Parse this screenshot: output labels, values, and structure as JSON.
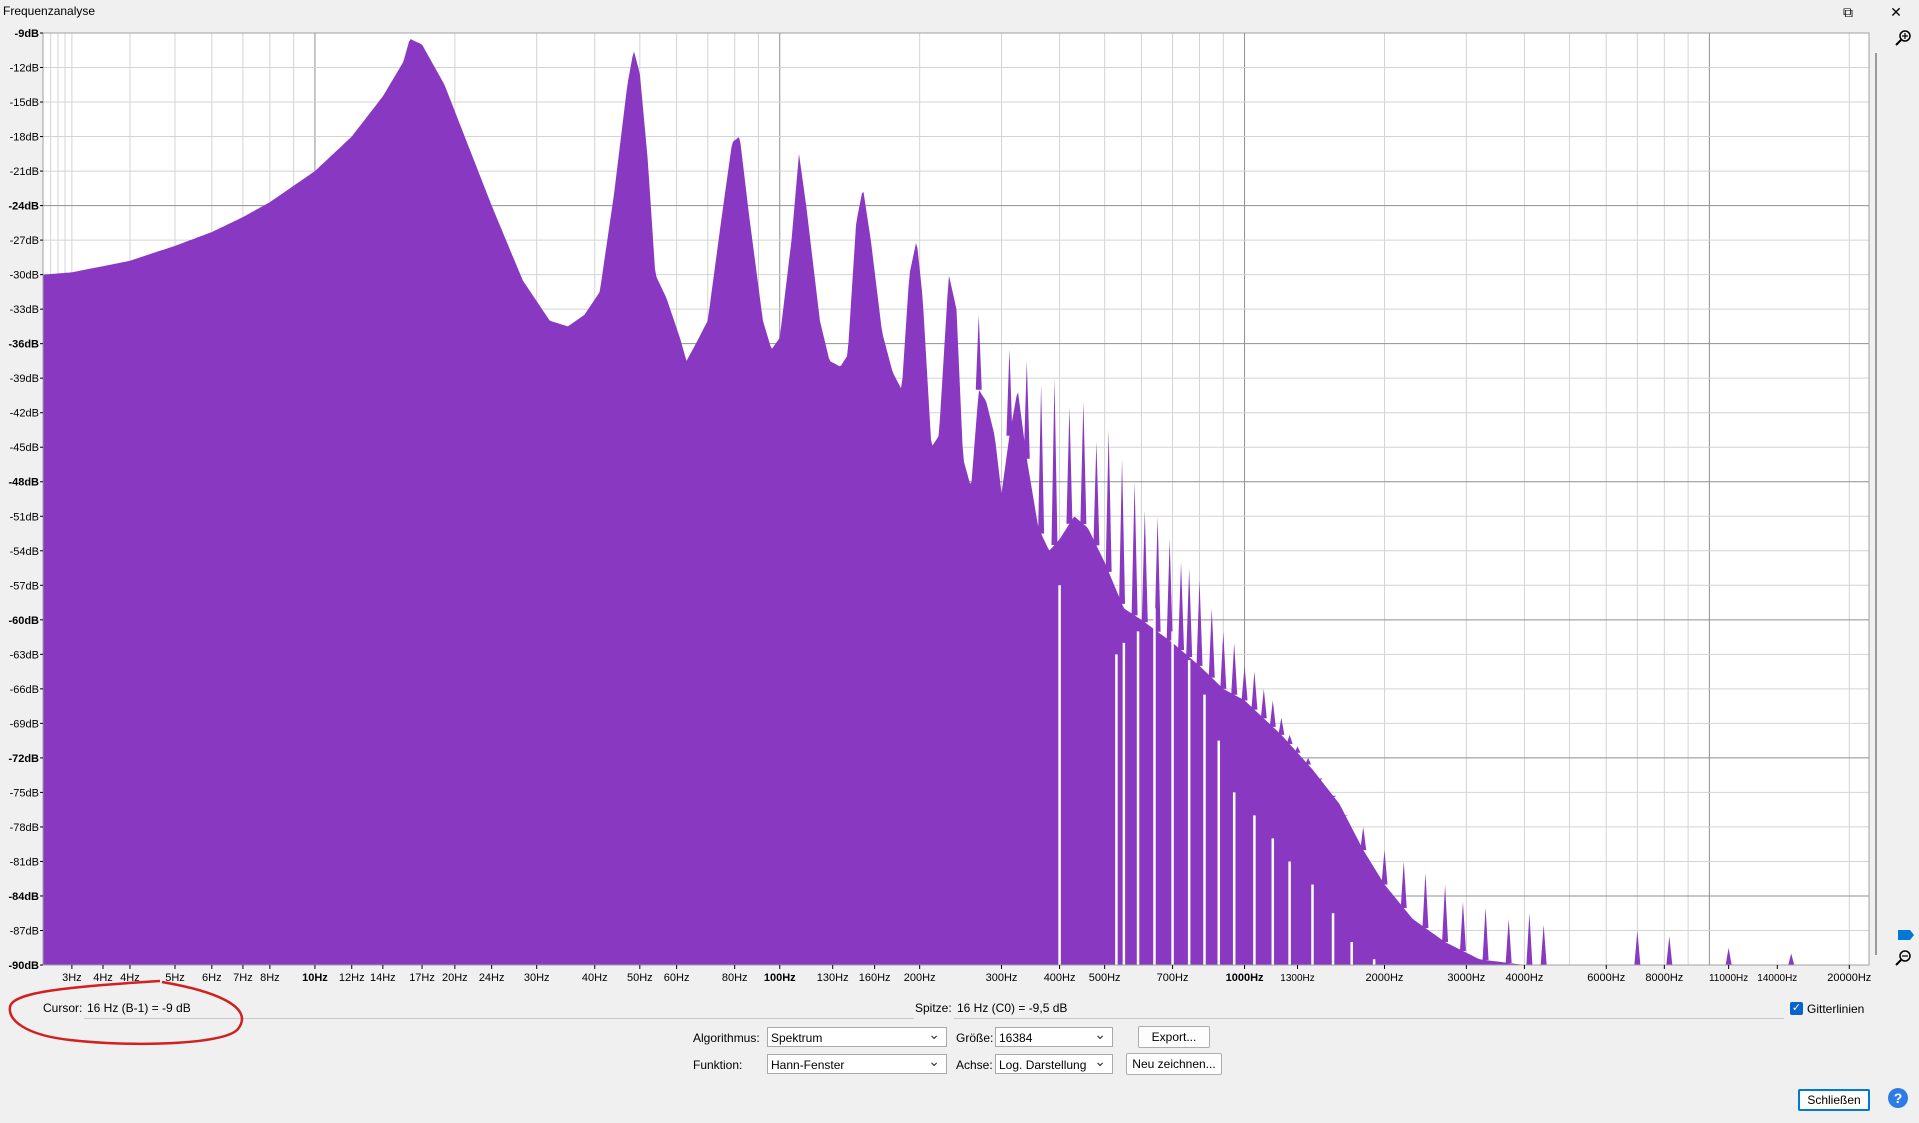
{
  "window": {
    "title": "Frequenzanalyse",
    "maximize_glyph": "⧉",
    "close_glyph": "✕"
  },
  "status": {
    "cursor_label": "Cursor:",
    "cursor_value": "16 Hz (B-1) = -9 dB",
    "peak_label": "Spitze:",
    "peak_value": "16 Hz (C0) = -9,5 dB",
    "grid_label": "Gitterlinien",
    "grid_checked": true
  },
  "controls": {
    "algorithm_label": "Algorithmus:",
    "algorithm_value": "Spektrum",
    "function_label": "Funktion:",
    "function_value": "Hann-Fenster",
    "size_label": "Größe:",
    "size_value": "16384",
    "axis_label": "Achse:",
    "axis_value": "Log. Darstellung",
    "export_label": "Export...",
    "redraw_label": "Neu zeichnen...",
    "close_label": "Schließen",
    "help_icon": "help-icon"
  },
  "colors": {
    "spectrum_fill": "#8939c1",
    "plot_bg": "#ffffff",
    "grid_minor": "#d4d4d4",
    "grid_major": "#8f8f8f",
    "annotation": "#d21f1f",
    "accent": "#0078d7"
  },
  "chart_data": {
    "type": "area",
    "xscale": "log",
    "xlim": [
      2.6,
      22050
    ],
    "ylim": [
      -90,
      -9
    ],
    "grid": true,
    "x_unit": "Hz",
    "y_unit": "dB",
    "y_ticks": [
      "-9dB",
      "-12dB",
      "-15dB",
      "-18dB",
      "-21dB",
      "-24dB",
      "-27dB",
      "-30dB",
      "-33dB",
      "-36dB",
      "-39dB",
      "-42dB",
      "-45dB",
      "-48dB",
      "-51dB",
      "-54dB",
      "-57dB",
      "-60dB",
      "-63dB",
      "-66dB",
      "-69dB",
      "-72dB",
      "-75dB",
      "-78dB",
      "-81dB",
      "-84dB",
      "-87dB",
      "-90dB"
    ],
    "y_ticks_bold": [
      "-9dB",
      "-24dB",
      "-36dB",
      "-48dB",
      "-60dB",
      "-72dB",
      "-84dB",
      "-90dB"
    ],
    "x_ticks": [
      {
        "label": "3Hz",
        "value": 3
      },
      {
        "label": "4Hz",
        "value": 3.5
      },
      {
        "label": "4Hz",
        "value": 4
      },
      {
        "label": "5Hz",
        "value": 5
      },
      {
        "label": "6Hz",
        "value": 6
      },
      {
        "label": "7Hz",
        "value": 7
      },
      {
        "label": "8Hz",
        "value": 8
      },
      {
        "label": "10Hz",
        "value": 10,
        "bold": true
      },
      {
        "label": "12Hz",
        "value": 12
      },
      {
        "label": "14Hz",
        "value": 14
      },
      {
        "label": "17Hz",
        "value": 17
      },
      {
        "label": "20Hz",
        "value": 20
      },
      {
        "label": "24Hz",
        "value": 24
      },
      {
        "label": "30Hz",
        "value": 30
      },
      {
        "label": "40Hz",
        "value": 40
      },
      {
        "label": "50Hz",
        "value": 50
      },
      {
        "label": "60Hz",
        "value": 60
      },
      {
        "label": "80Hz",
        "value": 80
      },
      {
        "label": "100Hz",
        "value": 100,
        "bold": true
      },
      {
        "label": "130Hz",
        "value": 130
      },
      {
        "label": "160Hz",
        "value": 160
      },
      {
        "label": "200Hz",
        "value": 200
      },
      {
        "label": "300Hz",
        "value": 300
      },
      {
        "label": "400Hz",
        "value": 400
      },
      {
        "label": "500Hz",
        "value": 500
      },
      {
        "label": "700Hz",
        "value": 700
      },
      {
        "label": "1000Hz",
        "value": 1000,
        "bold": true
      },
      {
        "label": "1300Hz",
        "value": 1300
      },
      {
        "label": "2000Hz",
        "value": 2000
      },
      {
        "label": "3000Hz",
        "value": 3000
      },
      {
        "label": "4000Hz",
        "value": 4000
      },
      {
        "label": "6000Hz",
        "value": 6000
      },
      {
        "label": "8000Hz",
        "value": 8000
      },
      {
        "label": "11000Hz",
        "value": 11000
      },
      {
        "label": "14000Hz",
        "value": 14000
      },
      {
        "label": "20000Hz",
        "value": 20000
      }
    ],
    "envelope": [
      [
        2.6,
        -30
      ],
      [
        3,
        -29.8
      ],
      [
        4,
        -28.8
      ],
      [
        5,
        -27.5
      ],
      [
        6,
        -26.3
      ],
      [
        7,
        -25
      ],
      [
        8,
        -23.7
      ],
      [
        10,
        -21
      ],
      [
        12,
        -18
      ],
      [
        14,
        -14.5
      ],
      [
        15.5,
        -11.5
      ],
      [
        16,
        -9.5
      ],
      [
        17,
        -10
      ],
      [
        19,
        -13.5
      ],
      [
        21,
        -18
      ],
      [
        24,
        -24
      ],
      [
        28,
        -30.5
      ],
      [
        32,
        -34
      ],
      [
        35,
        -34.5
      ],
      [
        38,
        -33.5
      ],
      [
        41,
        -31.5
      ],
      [
        44,
        -23
      ],
      [
        47,
        -13.5
      ],
      [
        48.5,
        -10.5
      ],
      [
        50,
        -12.5
      ],
      [
        52,
        -20
      ],
      [
        54,
        -30
      ],
      [
        57,
        -32
      ],
      [
        61,
        -35.5
      ],
      [
        63,
        -37.5
      ],
      [
        66,
        -36
      ],
      [
        70,
        -34
      ],
      [
        75,
        -25
      ],
      [
        79,
        -18.5
      ],
      [
        82,
        -18
      ],
      [
        86,
        -25
      ],
      [
        92,
        -34
      ],
      [
        96,
        -36.5
      ],
      [
        100,
        -35.5
      ],
      [
        106,
        -27
      ],
      [
        110,
        -19.5
      ],
      [
        114,
        -24
      ],
      [
        122,
        -34
      ],
      [
        128,
        -37.5
      ],
      [
        135,
        -38
      ],
      [
        140,
        -37
      ],
      [
        146,
        -25.5
      ],
      [
        151,
        -22.5
      ],
      [
        157,
        -27
      ],
      [
        166,
        -35
      ],
      [
        175,
        -38.5
      ],
      [
        183,
        -40
      ],
      [
        190,
        -30
      ],
      [
        197,
        -27
      ],
      [
        203,
        -32
      ],
      [
        212,
        -45
      ],
      [
        220,
        -44
      ],
      [
        231,
        -30
      ],
      [
        240,
        -33
      ],
      [
        248,
        -46
      ],
      [
        258,
        -48.5
      ],
      [
        268,
        -40
      ],
      [
        278,
        -41
      ],
      [
        290,
        -44
      ],
      [
        300,
        -49
      ],
      [
        312,
        -44
      ],
      [
        325,
        -40
      ],
      [
        340,
        -46
      ],
      [
        360,
        -52
      ],
      [
        380,
        -54
      ],
      [
        400,
        -53
      ],
      [
        430,
        -51
      ],
      [
        460,
        -52
      ],
      [
        500,
        -55
      ],
      [
        550,
        -59
      ],
      [
        600,
        -60
      ],
      [
        700,
        -62
      ],
      [
        800,
        -64
      ],
      [
        900,
        -66
      ],
      [
        1000,
        -67
      ],
      [
        1200,
        -70
      ],
      [
        1400,
        -73
      ],
      [
        1600,
        -76
      ],
      [
        1800,
        -80
      ],
      [
        2000,
        -83
      ],
      [
        2300,
        -86
      ],
      [
        2700,
        -88
      ],
      [
        3200,
        -89.5
      ],
      [
        4000,
        -90
      ]
    ],
    "peaks": [
      [
        16,
        -9.5
      ],
      [
        48.5,
        -10.5
      ],
      [
        82,
        -18
      ],
      [
        110,
        -19.5
      ],
      [
        151,
        -22.5
      ],
      [
        197,
        -27
      ],
      [
        231,
        -30
      ],
      [
        268,
        -33.5
      ],
      [
        312,
        -36.5
      ],
      [
        340,
        -37.5
      ],
      [
        365,
        -39.5
      ],
      [
        390,
        -39
      ],
      [
        420,
        -41.5
      ],
      [
        450,
        -41
      ],
      [
        480,
        -44.5
      ],
      [
        510,
        -43.5
      ],
      [
        545,
        -46
      ],
      [
        580,
        -48
      ],
      [
        610,
        -50.5
      ],
      [
        650,
        -51
      ],
      [
        690,
        -53
      ],
      [
        730,
        -55
      ],
      [
        760,
        -55.5
      ],
      [
        800,
        -56.5
      ],
      [
        850,
        -59
      ],
      [
        900,
        -61
      ],
      [
        950,
        -62
      ],
      [
        1000,
        -64
      ],
      [
        1050,
        -64.5
      ],
      [
        1100,
        -66
      ],
      [
        1150,
        -67
      ],
      [
        1200,
        -68.5
      ],
      [
        1250,
        -70
      ],
      [
        1300,
        -71
      ],
      [
        1370,
        -72
      ],
      [
        1450,
        -74
      ],
      [
        1550,
        -75.5
      ],
      [
        1650,
        -77
      ],
      [
        1800,
        -78
      ],
      [
        2000,
        -80
      ],
      [
        2200,
        -81
      ],
      [
        2450,
        -82
      ],
      [
        2700,
        -83
      ],
      [
        2950,
        -84.5
      ],
      [
        3300,
        -85
      ],
      [
        3700,
        -86
      ],
      [
        4100,
        -85.5
      ],
      [
        4400,
        -86.5
      ],
      [
        7000,
        -87
      ],
      [
        8200,
        -87.5
      ],
      [
        11000,
        -88.5
      ],
      [
        15000,
        -89
      ]
    ],
    "valleys": [
      [
        400,
        -57
      ],
      [
        530,
        -63
      ],
      [
        550,
        -62
      ],
      [
        590,
        -61
      ],
      [
        640,
        -59
      ],
      [
        700,
        -61
      ],
      [
        760,
        -63.5
      ],
      [
        820,
        -66.5
      ],
      [
        880,
        -70.5
      ],
      [
        950,
        -75
      ],
      [
        1050,
        -77
      ],
      [
        1150,
        -79
      ],
      [
        1250,
        -81
      ],
      [
        1400,
        -83
      ],
      [
        1550,
        -85.5
      ],
      [
        1700,
        -88
      ],
      [
        1900,
        -89.5
      ]
    ]
  }
}
